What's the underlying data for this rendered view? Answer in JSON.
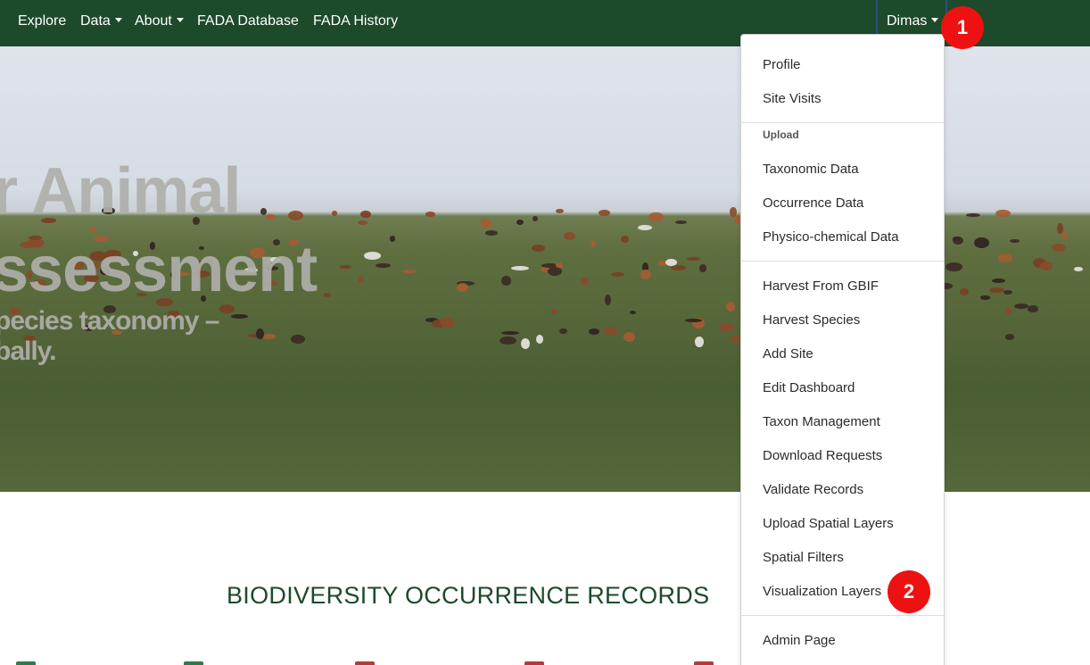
{
  "navbar": {
    "items": [
      {
        "label": "Explore"
      },
      {
        "label": "Data"
      },
      {
        "label": "About"
      },
      {
        "label": "FADA Database"
      },
      {
        "label": "FADA History"
      }
    ],
    "user": {
      "label": "Dimas"
    },
    "background": "#1c4a2a"
  },
  "hero": {
    "title_line1": "r Animal",
    "title_line2": "ssessment",
    "subtitle_line1": "pecies taxonomy –",
    "subtitle_line2": "bally."
  },
  "section": {
    "heading": "BIODIVERSITY OCCURRENCE RECORDS"
  },
  "user_menu": {
    "items_top": [
      {
        "label": "Profile"
      },
      {
        "label": "Site Visits"
      }
    ],
    "upload_header": "Upload",
    "upload_items": [
      {
        "label": "Taxonomic Data"
      },
      {
        "label": "Occurrence Data"
      },
      {
        "label": "Physico-chemical Data"
      }
    ],
    "manage_items": [
      {
        "label": "Harvest From GBIF"
      },
      {
        "label": "Harvest Species"
      },
      {
        "label": "Add Site"
      },
      {
        "label": "Edit Dashboard"
      },
      {
        "label": "Taxon Management"
      },
      {
        "label": "Download Requests"
      },
      {
        "label": "Validate Records"
      },
      {
        "label": "Upload Spatial Layers"
      },
      {
        "label": "Spatial Filters"
      },
      {
        "label": "Visualization Layers"
      }
    ],
    "admin_items": [
      {
        "label": "Admin Page"
      }
    ]
  },
  "annotations": {
    "badge_1": "1",
    "badge_2": "2",
    "color": "#ee1111"
  }
}
